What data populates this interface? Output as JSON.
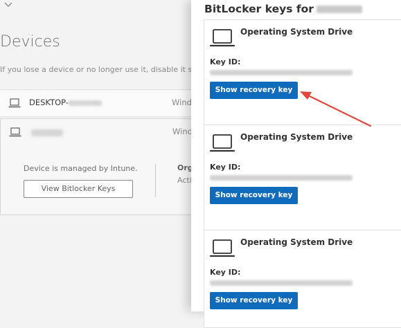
{
  "left_page": {
    "title": "Devices",
    "description": "If you lose a device or no longer use it, disable it so no o",
    "devices": [
      {
        "name_prefix": "DESKTOP-",
        "os": "Wind"
      },
      {
        "os": "Wind"
      }
    ],
    "expanded": {
      "managed_text": "Device is managed by Intune.",
      "view_keys_label": "View Bitlocker Keys",
      "org_label": "Orga",
      "org_status": "Activ"
    }
  },
  "panel": {
    "title": "BitLocker keys for",
    "cards": [
      {
        "drive": "Operating System Drive",
        "key_id_label": "Key ID:",
        "button": "Show recovery key"
      },
      {
        "drive": "Operating System Drive",
        "key_id_label": "Key ID:",
        "button": "Show recovery key"
      },
      {
        "drive": "Operating System Drive",
        "key_id_label": "Key ID:",
        "button": "Show recovery key"
      }
    ]
  },
  "colors": {
    "primary_button": "#0f6cbd",
    "annotation_arrow": "#e0463a"
  },
  "icons": {
    "device": "laptop-icon",
    "collapse": "chevron-down-icon"
  }
}
